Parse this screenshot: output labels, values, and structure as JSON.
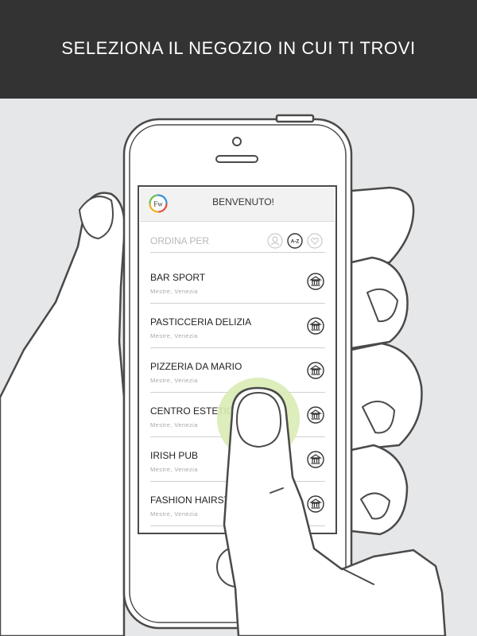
{
  "header": {
    "title": "SELEZIONA IL NEGOZIO IN CUI TI TROVI"
  },
  "app": {
    "logo_text": "Fw",
    "welcome": "BENVENUTO!",
    "sort": {
      "label": "ORDINA PER",
      "options": [
        {
          "icon": "user-icon",
          "label": "",
          "selected": false
        },
        {
          "icon": "az-sort-icon",
          "label": "A-Z",
          "selected": true
        },
        {
          "icon": "heart-icon",
          "label": "",
          "selected": false
        }
      ]
    },
    "stores": [
      {
        "name": "BAR SPORT",
        "location": "Mestre, Venezia"
      },
      {
        "name": "PASTICCERIA DELIZIA",
        "location": "Mestre, Venezia"
      },
      {
        "name": "PIZZERIA DA MARIO",
        "location": "Mestre, Venezia"
      },
      {
        "name": "CENTRO ESTETIC",
        "location": "Mestre, Venezia"
      },
      {
        "name": "IRISH PUB",
        "location": "Mestre, Venezia"
      },
      {
        "name": "FASHION HAIRST",
        "location": "Mestre, Venezia"
      }
    ]
  },
  "colors": {
    "header_bg": "#333333",
    "background": "#e6e7e8",
    "touch_highlight": "#d9ebb4",
    "outline": "#4a4a4a"
  }
}
